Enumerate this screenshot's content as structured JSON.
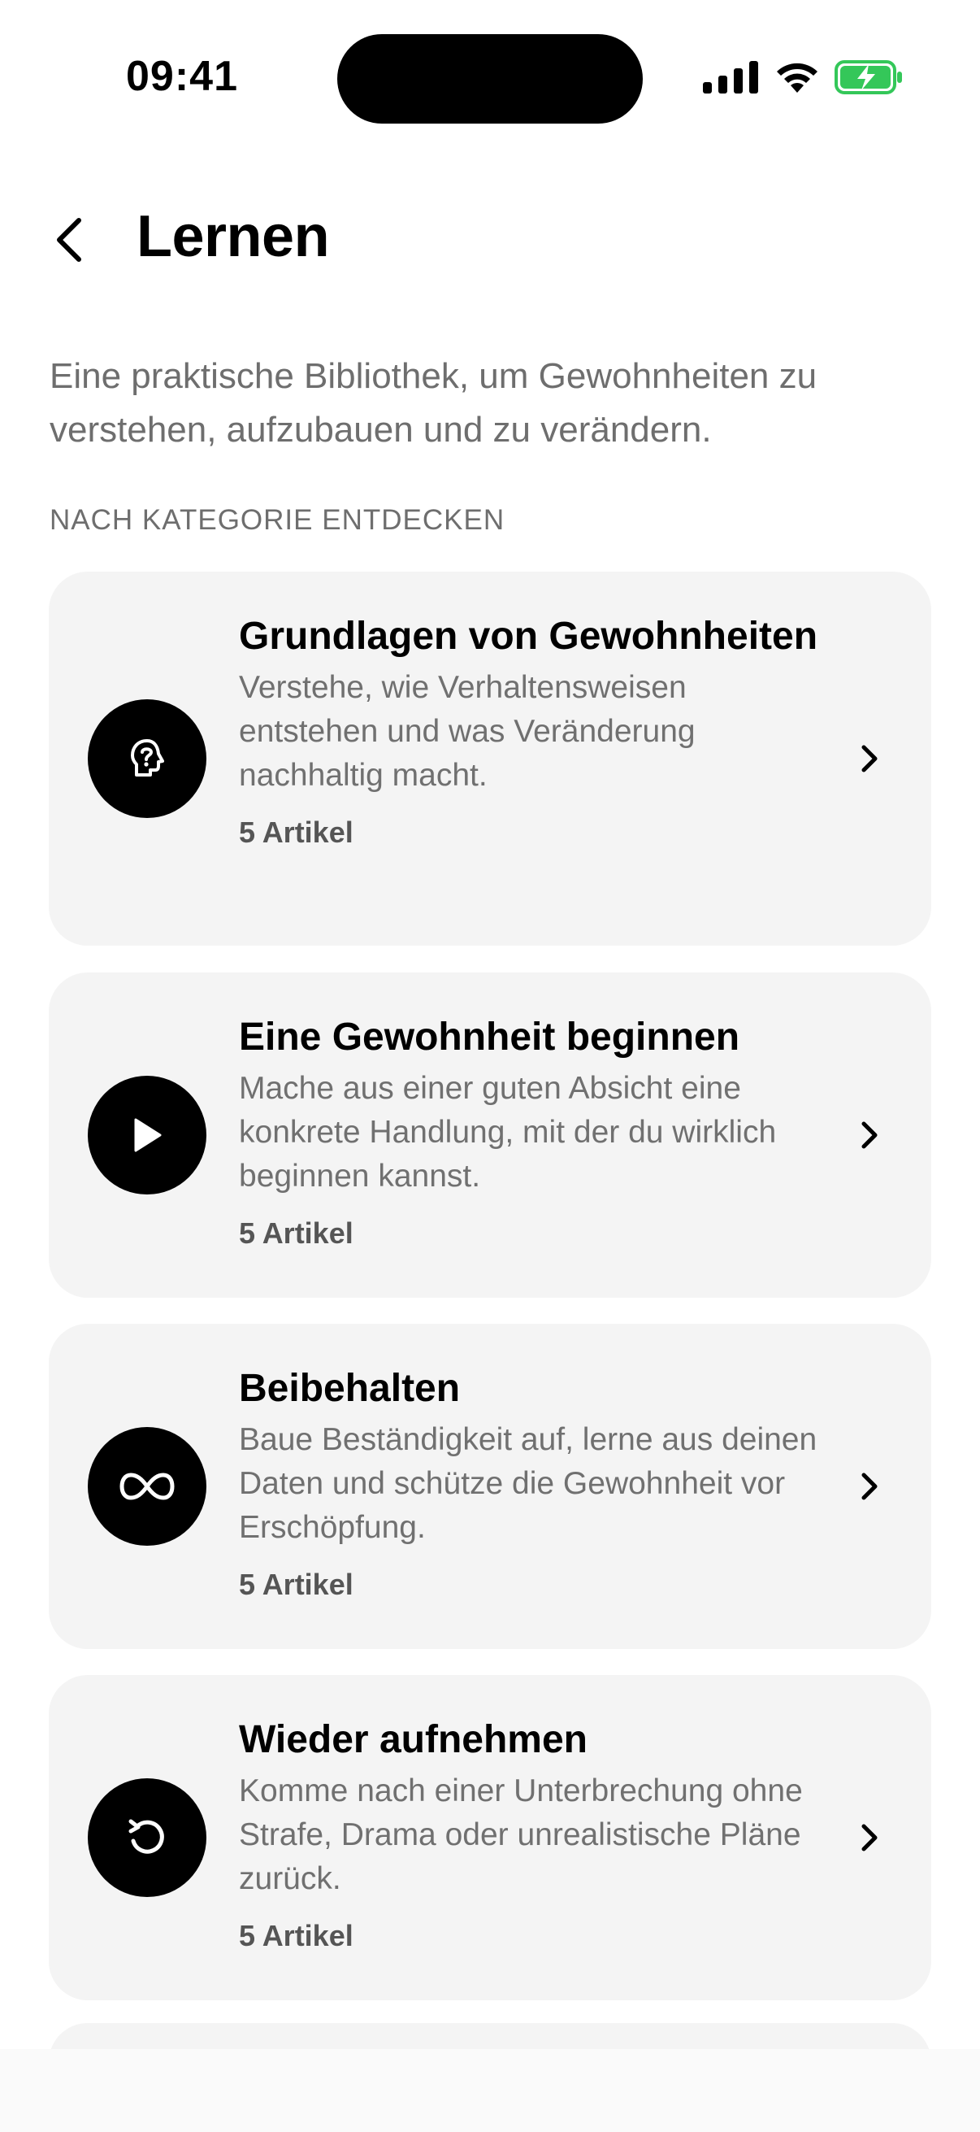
{
  "status": {
    "time": "09:41"
  },
  "header": {
    "title": "Lernen"
  },
  "intro": "Eine praktische Bibliothek, um Gewohnheiten zu verstehen, aufzubauen und zu verändern.",
  "section_label": "NACH KATEGORIE ENTDECKEN",
  "categories": [
    {
      "title": "Grundlagen von Gewohnheiten",
      "description": "Verstehe, wie Verhaltensweisen entstehen und was Veränderung nachhaltig macht.",
      "count": "5 Artikel",
      "icon": "head-question-icon"
    },
    {
      "title": "Eine Gewohnheit beginnen",
      "description": "Mache aus einer guten Absicht eine konkrete Handlung, mit der du wirklich beginnen kannst.",
      "count": "5 Artikel",
      "icon": "play-icon"
    },
    {
      "title": "Beibehalten",
      "description": "Baue Beständigkeit auf, lerne aus deinen Daten und schütze die Gewohnheit vor Erschöpfung.",
      "count": "5 Artikel",
      "icon": "infinity-icon"
    },
    {
      "title": "Wieder aufnehmen",
      "description": "Komme nach einer Unterbrechung ohne Strafe, Drama oder unrealistische Pläne zurück.",
      "count": "5 Artikel",
      "icon": "restart-icon"
    }
  ],
  "colors": {
    "card_bg": "#f4f4f4",
    "muted_text": "#6e6e6e",
    "battery": "#34c759"
  }
}
